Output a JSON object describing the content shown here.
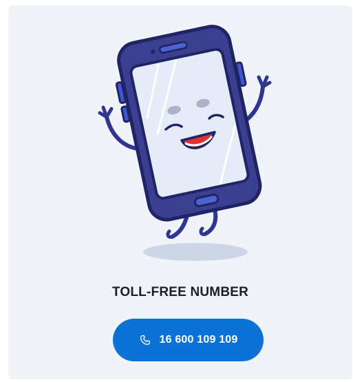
{
  "section": {
    "title": "TOLL-FREE NUMBER",
    "illustration_icon": "happy-smartphone-illustration"
  },
  "call_button": {
    "icon": "phone-icon",
    "number": "16 600 109 109",
    "color": "#0c72d6"
  },
  "colors": {
    "card_background": "#f0f3f8",
    "phone_body": "#3a3f8f",
    "phone_outline": "#1f2466",
    "screen": "#e6ecf7"
  }
}
